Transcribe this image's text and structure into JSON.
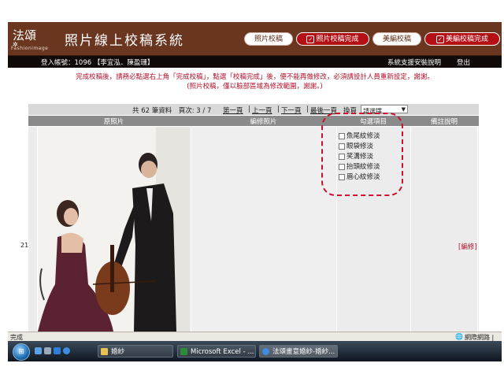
{
  "header": {
    "logo_text": "法頌",
    "logo_sub": "Fashionimage",
    "title": "照片線上校稿系統",
    "buttons": [
      {
        "label": "照片校稿",
        "style": "white",
        "checked": false
      },
      {
        "label": "照片校稿完成",
        "style": "red",
        "checked": true
      },
      {
        "label": "美編校稿",
        "style": "white",
        "checked": false
      },
      {
        "label": "美編校稿完成",
        "style": "red",
        "checked": true
      }
    ]
  },
  "userbar": {
    "login_info": "登入帳號：1096  【李宜泓．陳盈珊】",
    "support_link": "系統支援安裝說明",
    "logout_link": "登出"
  },
  "notices": {
    "line1": "完成校稿後，請務必點選右上角「完成校稿」，點選「校稿完成」後，便不能再做修改，必須請設計人員重新設定，謝謝。",
    "line2": "(照片校稿，僅以臉部區域為修改範圍，謝謝。)"
  },
  "pager": {
    "summary": "共 62 筆資料　頁次: 3 / 7",
    "first": "第一頁",
    "prev": "上一頁",
    "next": "下一頁",
    "last": "最後一頁",
    "jump_label": "換頁",
    "select_value": "請選擇"
  },
  "table": {
    "headers": [
      "原照片",
      "編修照片",
      "勾選項目",
      "備註說明"
    ],
    "row_number": "21",
    "options": [
      "魚尾紋修淡",
      "眼袋修淡",
      "笑溝修淡",
      "抬頭紋修淡",
      "眉心紋修淡"
    ],
    "action": "[編修]"
  },
  "statusbar": {
    "left": "完成",
    "right": "網際網路 | 受"
  },
  "taskbar": {
    "tasks": [
      "婚紗",
      "Microsoft Excel - ...",
      "法頌畫意婚紗-婚紗..."
    ]
  },
  "colors": {
    "header_bg": "#6b3620",
    "accent_red": "#b30f15",
    "notice_red": "#b2102a"
  }
}
